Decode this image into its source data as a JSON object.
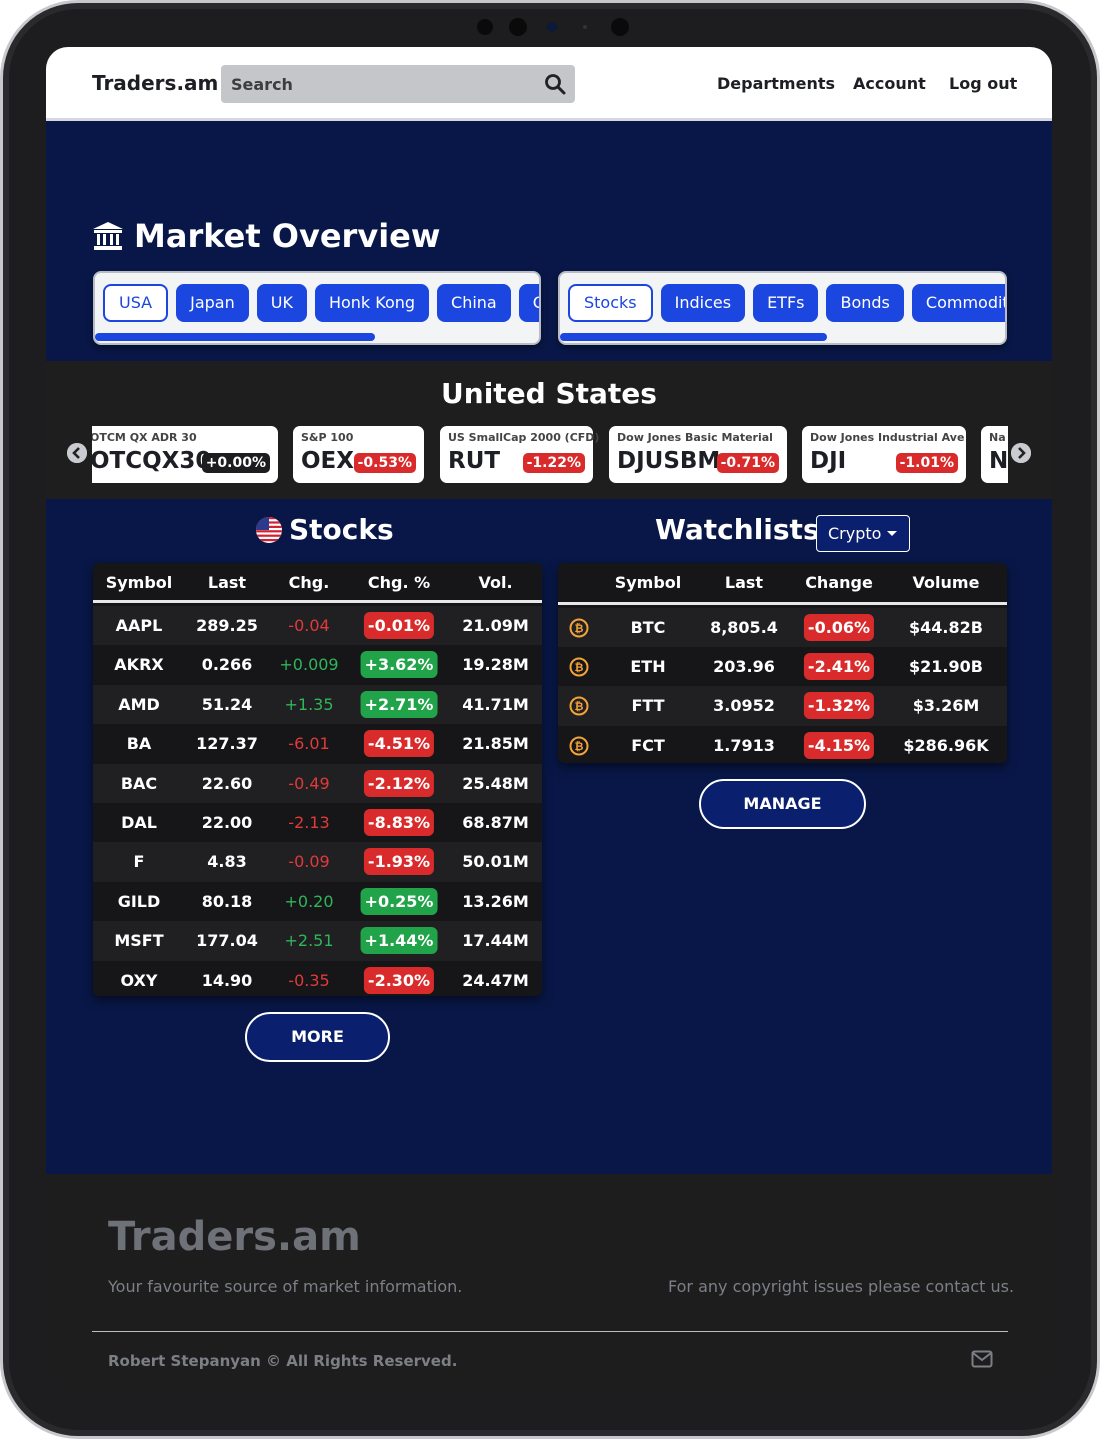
{
  "nav": {
    "brand": "Traders.am",
    "search_placeholder": "Search",
    "links": [
      "Departments",
      "Account",
      "Log out"
    ]
  },
  "market_overview": {
    "title": "Market Overview",
    "regions": [
      "USA",
      "Japan",
      "UK",
      "Honk Kong",
      "China",
      "Ca"
    ],
    "active_region": "USA",
    "regions_scroll_fraction": 0.63,
    "asset_types": [
      "Stocks",
      "Indices",
      "ETFs",
      "Bonds",
      "Commoditie"
    ],
    "active_asset_type": "Stocks",
    "asset_types_scroll_fraction": 0.6
  },
  "band": {
    "title": "United States",
    "tickers": [
      {
        "name": "OTCM QX ADR 30",
        "symbol": "OTCQX30",
        "change": "+0.00%",
        "tone": "neutral"
      },
      {
        "name": "S&P 100",
        "symbol": "OEX",
        "change": "-0.53%",
        "tone": "neg"
      },
      {
        "name": "US SmallCap 2000 (CFD)",
        "symbol": "RUT",
        "change": "-1.22%",
        "tone": "neg"
      },
      {
        "name": "Dow Jones Basic Material",
        "symbol": "DJUSBM",
        "change": "-0.71%",
        "tone": "neg"
      },
      {
        "name": "Dow Jones Industrial Ave",
        "symbol": "DJI",
        "change": "-1.01%",
        "tone": "neg"
      },
      {
        "name": "Na",
        "symbol": "N",
        "change": "",
        "tone": "neg"
      }
    ]
  },
  "stocks": {
    "title": "Stocks",
    "columns": [
      "Symbol",
      "Last",
      "Chg.",
      "Chg. %",
      "Vol."
    ],
    "rows": [
      {
        "symbol": "AAPL",
        "last": "289.25",
        "chg": "-0.04",
        "pct": "-0.01%",
        "vol": "21.09M",
        "tone": "neg"
      },
      {
        "symbol": "AKRX",
        "last": "0.266",
        "chg": "+0.009",
        "pct": "+3.62%",
        "vol": "19.28M",
        "tone": "pos"
      },
      {
        "symbol": "AMD",
        "last": "51.24",
        "chg": "+1.35",
        "pct": "+2.71%",
        "vol": "41.71M",
        "tone": "pos"
      },
      {
        "symbol": "BA",
        "last": "127.37",
        "chg": "-6.01",
        "pct": "-4.51%",
        "vol": "21.85M",
        "tone": "neg"
      },
      {
        "symbol": "BAC",
        "last": "22.60",
        "chg": "-0.49",
        "pct": "-2.12%",
        "vol": "25.48M",
        "tone": "neg"
      },
      {
        "symbol": "DAL",
        "last": "22.00",
        "chg": "-2.13",
        "pct": "-8.83%",
        "vol": "68.87M",
        "tone": "neg"
      },
      {
        "symbol": "F",
        "last": "4.83",
        "chg": "-0.09",
        "pct": "-1.93%",
        "vol": "50.01M",
        "tone": "neg"
      },
      {
        "symbol": "GILD",
        "last": "80.18",
        "chg": "+0.20",
        "pct": "+0.25%",
        "vol": "13.26M",
        "tone": "pos"
      },
      {
        "symbol": "MSFT",
        "last": "177.04",
        "chg": "+2.51",
        "pct": "+1.44%",
        "vol": "17.44M",
        "tone": "pos"
      },
      {
        "symbol": "OXY",
        "last": "14.90",
        "chg": "-0.35",
        "pct": "-2.30%",
        "vol": "24.47M",
        "tone": "neg"
      }
    ],
    "more_label": "MORE"
  },
  "watchlists": {
    "title": "Watchlists",
    "dropdown_value": "Crypto",
    "columns": [
      "Symbol",
      "Last",
      "Change",
      "Volume"
    ],
    "rows": [
      {
        "icon": "bitcoin-icon",
        "symbol": "BTC",
        "last": "8,805.4",
        "change": "-0.06%",
        "volume": "$44.82B"
      },
      {
        "icon": "bitcoin-icon",
        "symbol": "ETH",
        "last": "203.96",
        "change": "-2.41%",
        "volume": "$21.90B"
      },
      {
        "icon": "bitcoin-icon",
        "symbol": "FTT",
        "last": "3.0952",
        "change": "-1.32%",
        "volume": "$3.26M"
      },
      {
        "icon": "bitcoin-icon",
        "symbol": "FCT",
        "last": "1.7913",
        "change": "-4.15%",
        "volume": "$286.96K"
      }
    ],
    "manage_label": "MANAGE"
  },
  "footer": {
    "brand": "Traders.am",
    "tagline": "Your favourite source of market information.",
    "contact": "For any copyright issues please contact us.",
    "copyright": "Robert Stepanyan © All Rights Reserved."
  },
  "colors": {
    "page_bg": "#081747",
    "accent_blue": "#1c46e0",
    "negative": "#d92b2b",
    "positive": "#21a34a",
    "band_bg": "#1e1e1f"
  }
}
